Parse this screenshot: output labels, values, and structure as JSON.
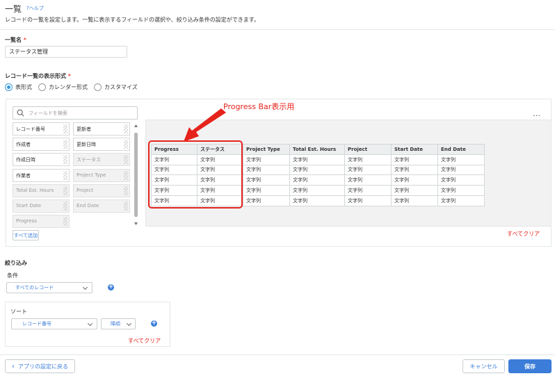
{
  "header": {
    "title": "一覧",
    "help_label": "?ヘルプ",
    "description": "レコードの一覧を設定します。一覧に表示するフィールドの選択や、絞り込み条件の設定ができます。"
  },
  "list_name": {
    "label": "一覧名",
    "required_mark": "*",
    "value": "ステータス管理"
  },
  "display_format": {
    "label": "レコード一覧の表示形式",
    "required_mark": "*",
    "options": [
      "表形式",
      "カレンダー形式",
      "カスタマイズ"
    ],
    "selected": "表形式"
  },
  "field_palette": {
    "search_placeholder": "フィールドを検索",
    "fields": [
      {
        "label": "レコード番号",
        "enabled": true
      },
      {
        "label": "更新者",
        "enabled": true
      },
      {
        "label": "作成者",
        "enabled": true
      },
      {
        "label": "更新日時",
        "enabled": true
      },
      {
        "label": "作成日時",
        "enabled": true
      },
      {
        "label": "ステータス",
        "enabled": false
      },
      {
        "label": "作業者",
        "enabled": true
      },
      {
        "label": "Project Type",
        "enabled": false
      },
      {
        "label": "Total Est. Hours",
        "enabled": false
      },
      {
        "label": "Project",
        "enabled": false
      },
      {
        "label": "Start Date",
        "enabled": false
      },
      {
        "label": "End Date",
        "enabled": false
      },
      {
        "label": "Progress",
        "enabled": false
      }
    ],
    "add_all_label": "すべて追加"
  },
  "preview": {
    "more_icon": "…",
    "columns": [
      "Progress",
      "ステータス",
      "Project Type",
      "Total Est. Hours",
      "Project",
      "Start Date",
      "End Date"
    ],
    "cell_text": "文字列",
    "row_count": 5,
    "clear_all_label": "すべてクリア"
  },
  "annotation": {
    "text": "Progress Bar表示用",
    "color": "#e5231b"
  },
  "filter": {
    "section_label": "絞り込み",
    "condition_label": "条件",
    "condition_value": "すべてのレコード"
  },
  "sort": {
    "label": "ソート",
    "field_value": "レコード番号",
    "order_value": "降順",
    "clear_all_label": "すべてクリア"
  },
  "footer": {
    "back_label": "アプリの設定に戻る",
    "cancel_label": "キャンセル",
    "save_label": "保存"
  },
  "colors": {
    "accent": "#3b7dd8",
    "danger": "#e5231b"
  }
}
